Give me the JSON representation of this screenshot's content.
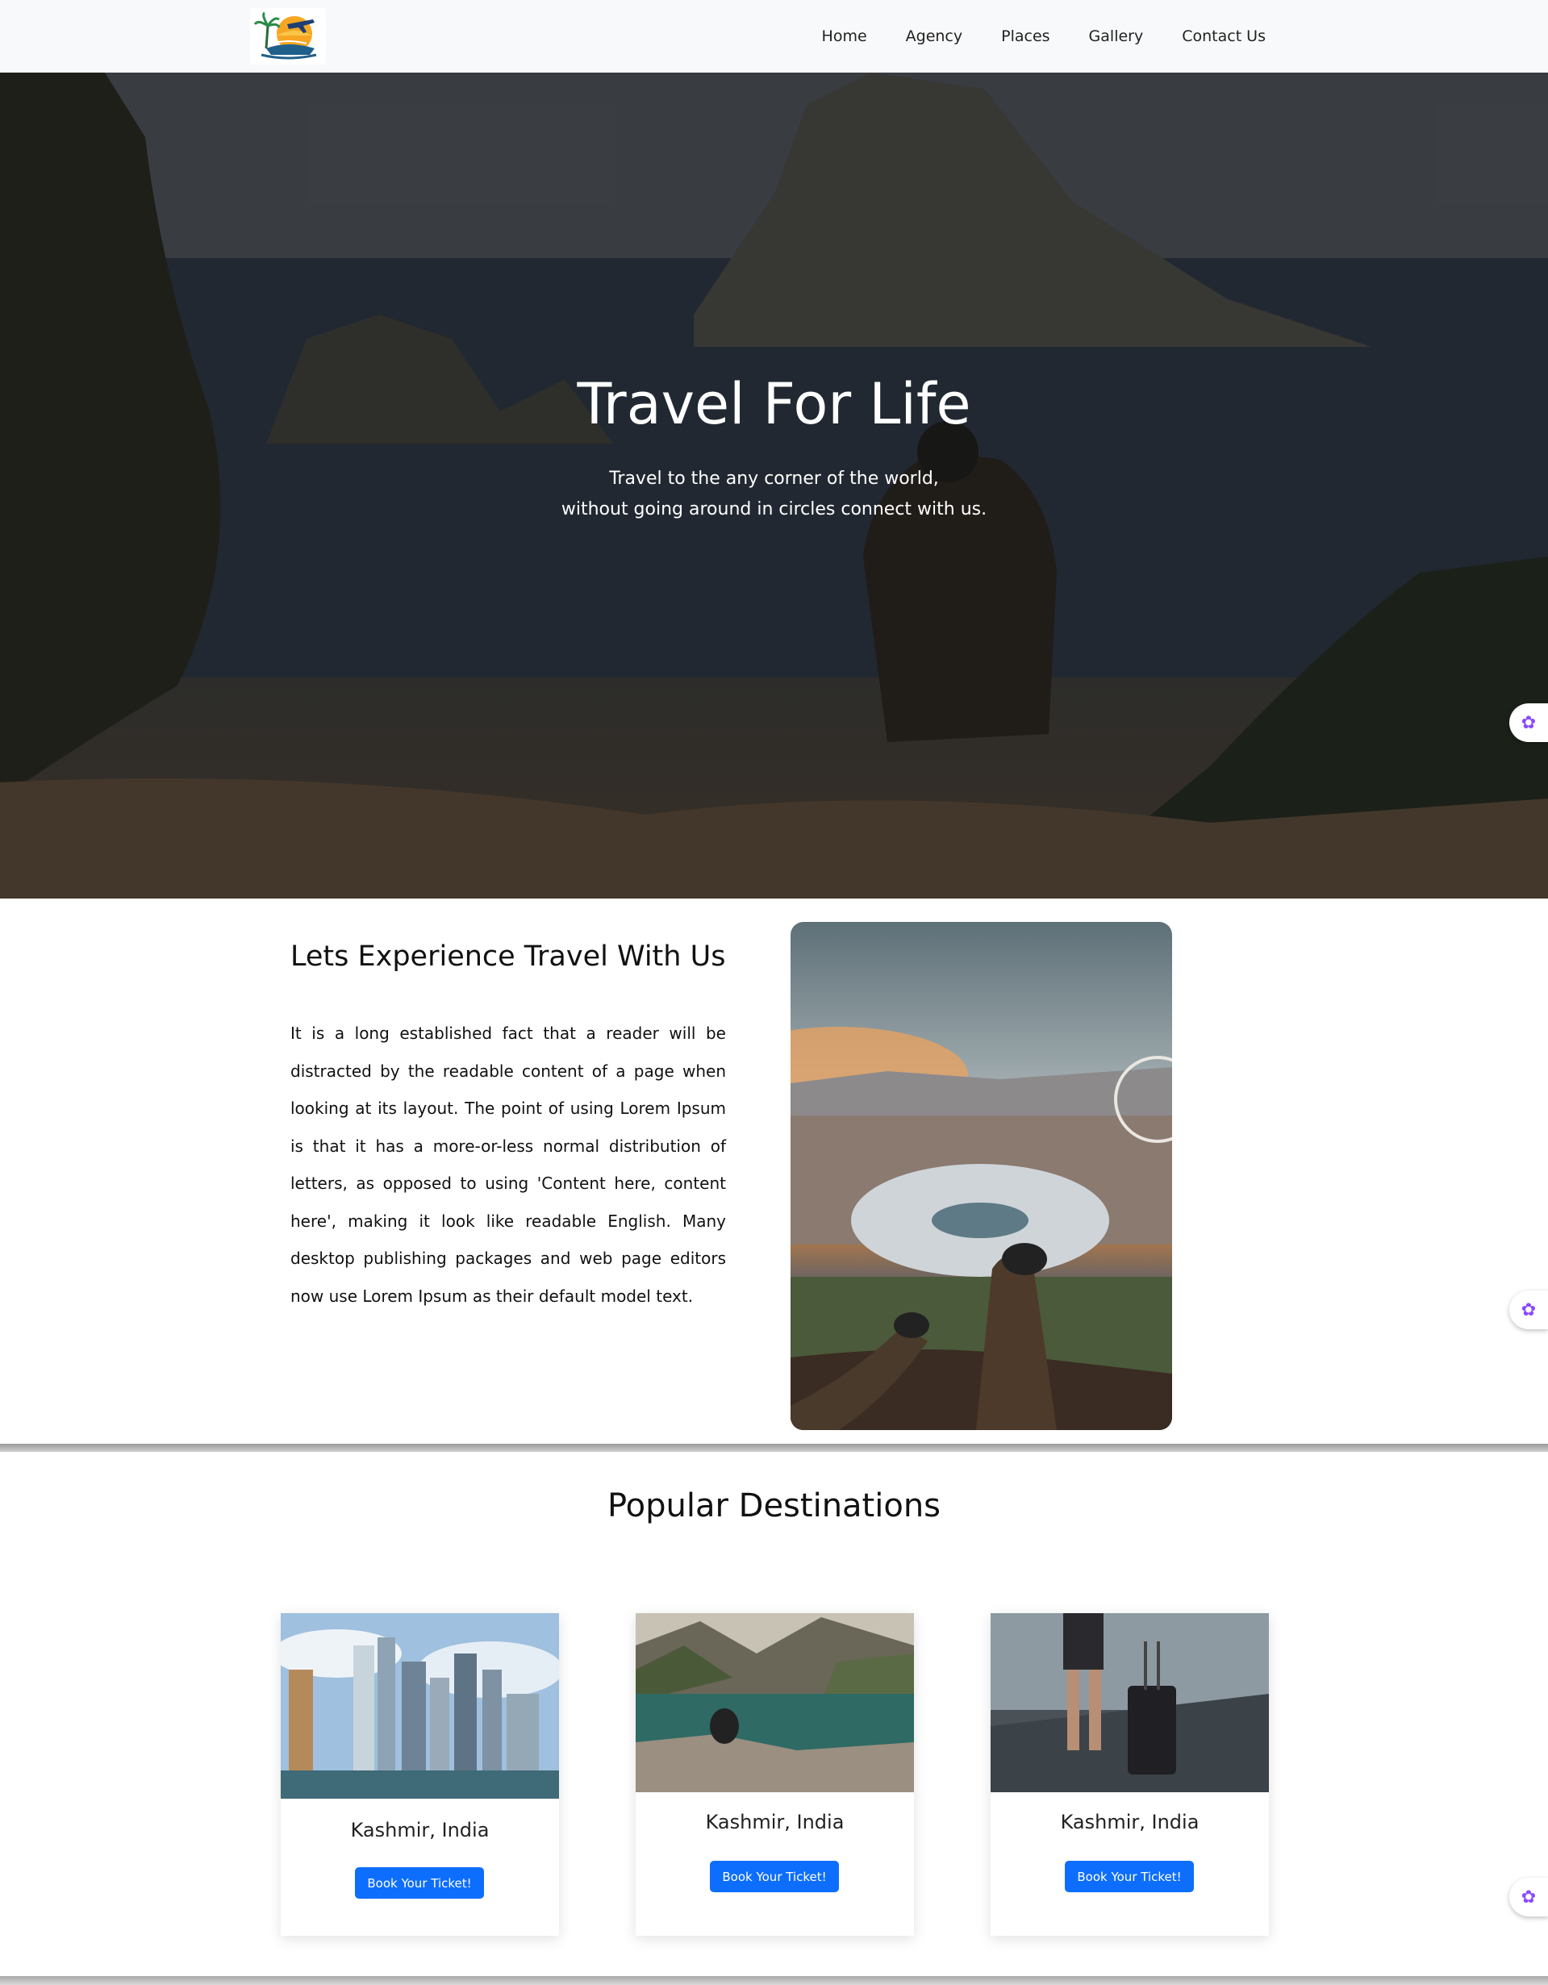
{
  "nav": {
    "links": [
      "Home",
      "Agency",
      "Places",
      "Gallery",
      "Contact Us"
    ]
  },
  "hero": {
    "title": "Travel For Life",
    "subtitle_line1": "Travel to the any corner of the world,",
    "subtitle_line2": "without going around in circles connect with us."
  },
  "about": {
    "heading": "Lets Experience Travel With Us",
    "body": "It is a long established fact that a reader will be distracted by the readable content of a page when looking at its layout. The point of using Lorem Ipsum is that it has a more-or-less normal distribution of letters, as opposed to using 'Content here, content here', making it look like readable English. Many desktop publishing packages and web page editors now use Lorem Ipsum as their default model text."
  },
  "destinations": {
    "heading": "Popular Destinations",
    "cards": [
      {
        "title": "Kashmir, India",
        "button": "Book Your Ticket!"
      },
      {
        "title": "Kashmir, India",
        "button": "Book Your Ticket!"
      },
      {
        "title": "Kashmir, India",
        "button": "Book Your Ticket!"
      }
    ]
  },
  "colors": {
    "primary_button": "#0d6efd",
    "navbar_bg": "#f8f9fa"
  },
  "icons": {
    "side_widget": "brain-icon"
  }
}
